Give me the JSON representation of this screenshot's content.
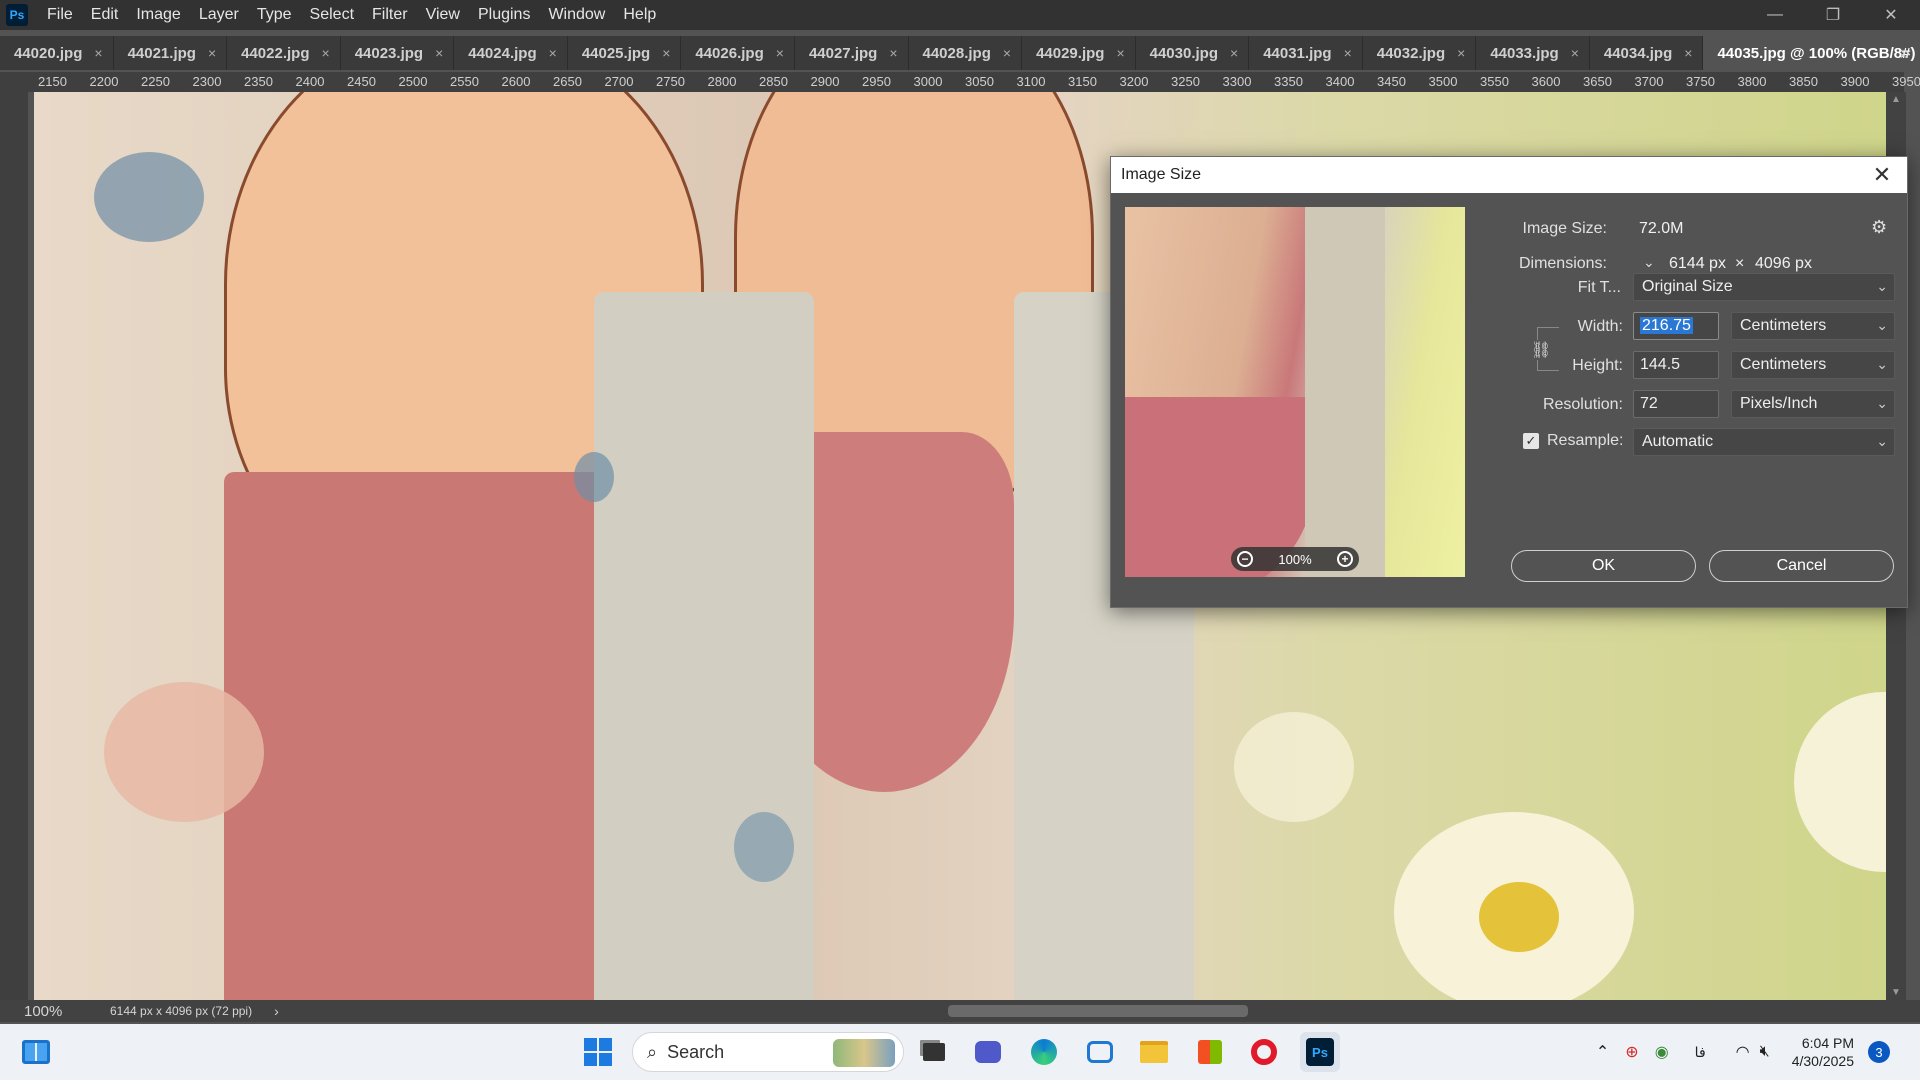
{
  "app": {
    "logo_text": "Ps"
  },
  "menu": [
    "File",
    "Edit",
    "Image",
    "Layer",
    "Type",
    "Select",
    "Filter",
    "View",
    "Plugins",
    "Window",
    "Help"
  ],
  "window_controls": {
    "minimize": "—",
    "restore": "❐",
    "close": "✕"
  },
  "tabs": [
    "44020.jpg",
    "44021.jpg",
    "44022.jpg",
    "44023.jpg",
    "44024.jpg",
    "44025.jpg",
    "44026.jpg",
    "44027.jpg",
    "44028.jpg",
    "44029.jpg",
    "44030.jpg",
    "44031.jpg",
    "44032.jpg",
    "44033.jpg",
    "44034.jpg",
    "44035.jpg @ 100% (RGB/8#)"
  ],
  "active_tab_index": 15,
  "ruler_marks": [
    "2150",
    "2200",
    "2250",
    "2300",
    "2350",
    "2400",
    "2450",
    "2500",
    "2550",
    "2600",
    "2650",
    "2700",
    "2750",
    "2800",
    "2850",
    "2900",
    "2950",
    "3000",
    "3050",
    "3100",
    "3150",
    "3200",
    "3250",
    "3300",
    "3350",
    "3400",
    "3450",
    "3500",
    "3550",
    "3600",
    "3650",
    "3700",
    "3750",
    "3800",
    "3850",
    "3900",
    "3950"
  ],
  "status": {
    "zoom": "100%",
    "doc_info": "6144 px x 4096 px (72 ppi)"
  },
  "dialog": {
    "title": "Image Size",
    "image_size_label": "Image Size:",
    "image_size_value": "72.0M",
    "dimensions_label": "Dimensions:",
    "dim_width": "6144 px",
    "dim_sep": "×",
    "dim_height": "4096 px",
    "fit_label": "Fit T...",
    "fit_value": "Original Size",
    "width_label": "Width:",
    "width_value": "216.75",
    "width_unit": "Centimeters",
    "height_label": "Height:",
    "height_value": "144.5",
    "height_unit": "Centimeters",
    "resolution_label": "Resolution:",
    "resolution_value": "72",
    "resolution_unit": "Pixels/Inch",
    "resample_label": "Resample:",
    "resample_checked": true,
    "resample_value": "Automatic",
    "preview_zoom": "100%",
    "ok_label": "OK",
    "cancel_label": "Cancel"
  },
  "taskbar": {
    "search_label": "Search",
    "clock_time": "6:04 PM",
    "clock_date": "4/30/2025",
    "lang": "فا",
    "notifications": "3"
  }
}
